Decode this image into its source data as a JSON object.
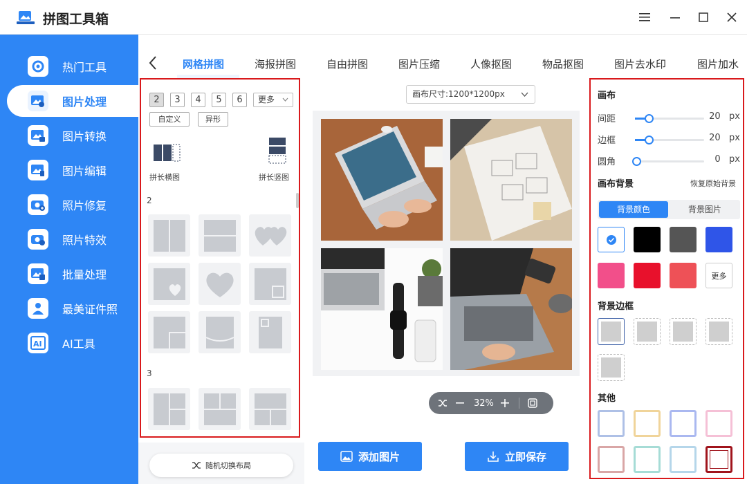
{
  "app": {
    "title": "拼图工具箱"
  },
  "window": {
    "menu_icon": "hamburger-icon",
    "min_icon": "minimize-icon",
    "max_icon": "maximize-icon",
    "close_icon": "close-icon"
  },
  "sidebar": {
    "items": [
      {
        "label": "热门工具",
        "icon": "gear-icon"
      },
      {
        "label": "图片处理",
        "icon": "image-icon",
        "active": true
      },
      {
        "label": "图片转换",
        "icon": "image-convert-icon"
      },
      {
        "label": "图片编辑",
        "icon": "image-edit-icon"
      },
      {
        "label": "照片修复",
        "icon": "camera-plus-icon"
      },
      {
        "label": "照片特效",
        "icon": "camera-effect-icon"
      },
      {
        "label": "批量处理",
        "icon": "batch-icon"
      },
      {
        "label": "最美证件照",
        "icon": "id-photo-icon"
      },
      {
        "label": "AI工具",
        "icon": "ai-icon"
      }
    ]
  },
  "tabs": [
    "网格拼图",
    "海报拼图",
    "自由拼图",
    "图片压缩",
    "人像抠图",
    "物品抠图",
    "图片去水印",
    "图片加水"
  ],
  "left": {
    "numbers": [
      "2",
      "3",
      "4",
      "5",
      "6"
    ],
    "more": "更多",
    "custom": "自定义",
    "irregular": "异形",
    "long_horizontal": "拼长横图",
    "long_vertical": "拼长竖图",
    "section2": "2",
    "section3": "3",
    "random": "随机切换布局"
  },
  "canvas": {
    "size_label": "画布尺寸:1200*1200px",
    "zoom": "32%"
  },
  "actions": {
    "add": "添加图片",
    "save": "立即保存"
  },
  "right": {
    "canvas_title": "画布",
    "spacing_label": "间距",
    "spacing_value": 20,
    "border_label": "边框",
    "border_value": 20,
    "radius_label": "圆角",
    "radius_value": 0,
    "unit": "px",
    "bg_title": "画布背景",
    "restore": "恢复原始背景",
    "bg_color_tab": "背景颜色",
    "bg_image_tab": "背景图片",
    "colors": [
      "#ffffff",
      "#000000",
      "#555555",
      "#2f55e8",
      "#f24f8a",
      "#e8112c",
      "#ee5157"
    ],
    "more": "更多",
    "border_title": "背景边框",
    "other_title": "其他"
  }
}
